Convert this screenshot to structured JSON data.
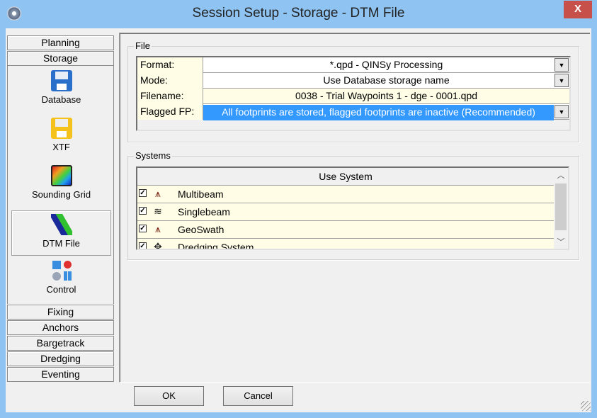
{
  "window": {
    "title": "Session Setup - Storage -  DTM File",
    "close_label": "X"
  },
  "nav": {
    "top": [
      "Planning",
      "Storage"
    ],
    "items": [
      {
        "label": "Database",
        "icon": "database-floppy-icon"
      },
      {
        "label": "XTF",
        "icon": "xtf-floppy-icon"
      },
      {
        "label": "Sounding Grid",
        "icon": "sounding-grid-icon"
      },
      {
        "label": "DTM File",
        "icon": "dtm-file-icon",
        "selected": true
      },
      {
        "label": "Control",
        "icon": "control-icon"
      }
    ],
    "bottom": [
      "Fixing",
      "Anchors",
      "Bargetrack",
      "Dredging",
      "Eventing"
    ]
  },
  "file": {
    "group_label": "File",
    "rows": [
      {
        "label": "Format:",
        "value": "*.qpd - QINSy Processing",
        "dropdown": true
      },
      {
        "label": "Mode:",
        "value": "Use Database storage name",
        "dropdown": true
      },
      {
        "label": "Filename:",
        "value": "0038 - Trial Waypoints 1 - dge - 0001.qpd",
        "dropdown": false
      },
      {
        "label": "Flagged FP:",
        "value": "All footprints are stored, flagged footprints are inactive (Recommended)",
        "dropdown": true
      }
    ]
  },
  "systems": {
    "group_label": "Systems",
    "header": "Use System",
    "rows": [
      {
        "name": "Multibeam",
        "checked": true,
        "icon": "multibeam-icon"
      },
      {
        "name": "Singlebeam",
        "checked": true,
        "icon": "singlebeam-icon"
      },
      {
        "name": "GeoSwath",
        "checked": true,
        "icon": "geoswath-icon"
      },
      {
        "name": "Dredging System",
        "checked": true,
        "icon": "dredging-system-icon"
      }
    ]
  },
  "buttons": {
    "ok": "OK",
    "cancel": "Cancel"
  },
  "colors": {
    "selection": "#3399ff",
    "cell_bg": "#fffde6",
    "titlebar": "#8ec3f2"
  }
}
